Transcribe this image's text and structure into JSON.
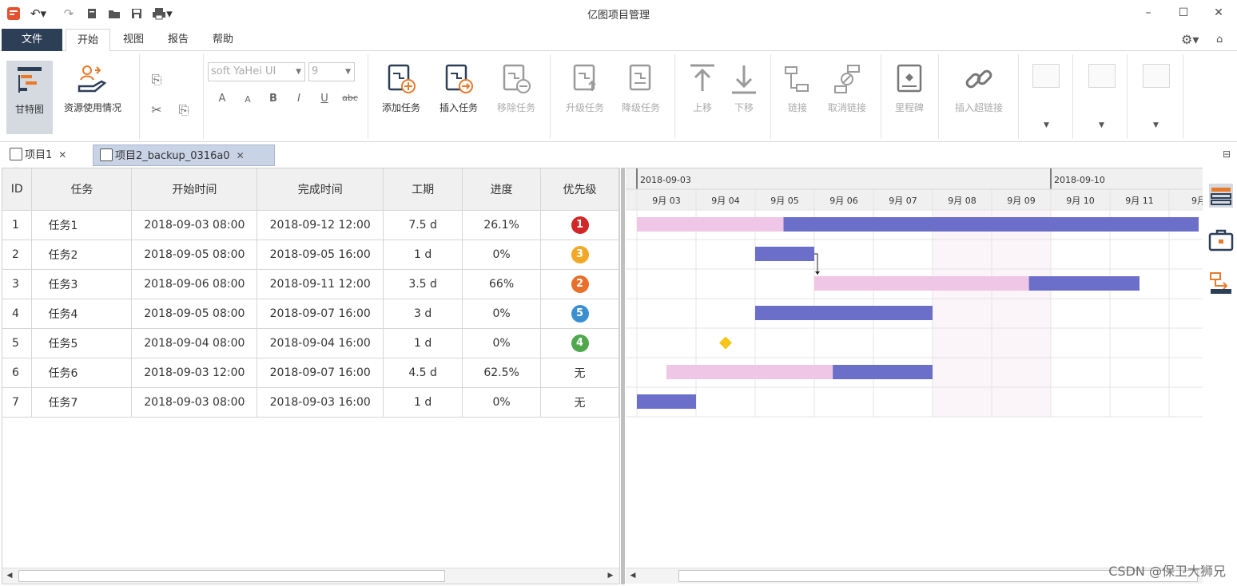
{
  "app_title": "亿图项目管理",
  "menu": {
    "file": "文件",
    "tabs": [
      "开始",
      "视图",
      "报告",
      "帮助"
    ]
  },
  "ribbon": {
    "gantt_label": "甘特图",
    "resource_label": "资源使用情况",
    "font_name": "soft YaHei UI",
    "font_size": "9",
    "format_buttons": [
      "A",
      "A",
      "B",
      "I",
      "U",
      "abc"
    ],
    "add_task": "添加任务",
    "insert_task": "插入任务",
    "remove_task": "移除任务",
    "upgrade_task": "升级任务",
    "downgrade_task": "降级任务",
    "move_up": "上移",
    "move_down": "下移",
    "link": "链接",
    "unlink": "取消链接",
    "milestone": "里程碑",
    "insert_hyperlink": "插入超链接"
  },
  "doc_tabs": [
    {
      "label": "项目1"
    },
    {
      "label": "项目2_backup_0316a0"
    }
  ],
  "table": {
    "headers": [
      "ID",
      "任务",
      "开始时间",
      "完成时间",
      "工期",
      "进度",
      "优先级"
    ],
    "rows": [
      {
        "id": "1",
        "task": "任务1",
        "start": "2018-09-03 08:00",
        "end": "2018-09-12 12:00",
        "duration": "7.5 d",
        "progress": "26.1%",
        "priority": "1",
        "priority_color": "#d12727"
      },
      {
        "id": "2",
        "task": "任务2",
        "start": "2018-09-05 08:00",
        "end": "2018-09-05 16:00",
        "duration": "1 d",
        "progress": "0%",
        "priority": "3",
        "priority_color": "#f2a826"
      },
      {
        "id": "3",
        "task": "任务3",
        "start": "2018-09-06 08:00",
        "end": "2018-09-11 12:00",
        "duration": "3.5 d",
        "progress": "66%",
        "priority": "2",
        "priority_color": "#e8702a"
      },
      {
        "id": "4",
        "task": "任务4",
        "start": "2018-09-05 08:00",
        "end": "2018-09-07 16:00",
        "duration": "3 d",
        "progress": "0%",
        "priority": "5",
        "priority_color": "#3b8fd1"
      },
      {
        "id": "5",
        "task": "任务5",
        "start": "2018-09-04 08:00",
        "end": "2018-09-04 16:00",
        "duration": "1 d",
        "progress": "0%",
        "priority": "4",
        "priority_color": "#4fa84b"
      },
      {
        "id": "6",
        "task": "任务6",
        "start": "2018-09-03 12:00",
        "end": "2018-09-07 16:00",
        "duration": "4.5 d",
        "progress": "62.5%",
        "priority": "无",
        "priority_color": ""
      },
      {
        "id": "7",
        "task": "任务7",
        "start": "2018-09-03 08:00",
        "end": "2018-09-03 16:00",
        "duration": "1 d",
        "progress": "0%",
        "priority": "无",
        "priority_color": ""
      }
    ]
  },
  "gantt": {
    "weeks": [
      "2018-09-03",
      "2018-09-10"
    ],
    "days": [
      "9月 03",
      "9月 04",
      "9月 05",
      "9月 06",
      "9月 07",
      "9月 08",
      "9月 09",
      "9月 10",
      "9月 11",
      "9月"
    ],
    "weekend_days": [
      5,
      6
    ],
    "bars": [
      {
        "row": 0,
        "start": 0,
        "end": 9.5,
        "done": 0.261,
        "order": "done-right"
      },
      {
        "row": 1,
        "start": 2,
        "end": 3,
        "done": 0,
        "order": "done-right"
      },
      {
        "row": 2,
        "start": 3,
        "end": 8.5,
        "done": 0.66,
        "order": "done-left"
      },
      {
        "row": 3,
        "start": 2,
        "end": 5,
        "done": 0,
        "order": "done-right"
      },
      {
        "row": 5,
        "start": 0.5,
        "end": 5,
        "done": 0.625,
        "order": "done-left"
      },
      {
        "row": 6,
        "start": 0,
        "end": 1,
        "done": 0,
        "order": "done-right"
      }
    ],
    "milestones": [
      {
        "row": 4,
        "day": 1.5
      }
    ],
    "links": [
      {
        "from_row": 1,
        "to_row": 2
      }
    ],
    "colors": {
      "bar_main": "#6c6fc9",
      "bar_light": "#efc6e6",
      "milestone": "#f5c518",
      "weekend": "#fbf4f9"
    }
  },
  "watermark": "CSDN @保卫大狮兄"
}
